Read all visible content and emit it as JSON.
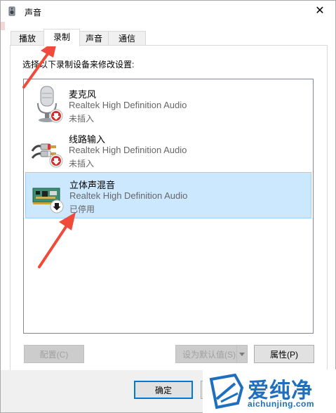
{
  "window": {
    "title": "声音",
    "close_glyph": "✕",
    "icon": "speaker-icon"
  },
  "tabs": [
    {
      "label": "播放",
      "active": false
    },
    {
      "label": "录制",
      "active": true
    },
    {
      "label": "声音",
      "active": false
    },
    {
      "label": "通信",
      "active": false
    }
  ],
  "panel": {
    "instruction": "选择以下录制设备来修改设置:"
  },
  "devices": [
    {
      "name": "麦克风",
      "driver": "Realtek High Definition Audio",
      "status": "未插入",
      "icon": "microphone-icon",
      "badge": "red-down-arrow-badge",
      "selected": false
    },
    {
      "name": "线路输入",
      "driver": "Realtek High Definition Audio",
      "status": "未插入",
      "icon": "line-in-cable-icon",
      "badge": "red-down-arrow-badge",
      "selected": false
    },
    {
      "name": "立体声混音",
      "driver": "Realtek High Definition Audio",
      "status": "已停用",
      "icon": "sound-card-icon",
      "badge": "black-down-arrow-badge",
      "selected": true
    }
  ],
  "buttons": {
    "configure": "配置(C)",
    "set_default": "设为默认值(S)",
    "properties": "属性(P)",
    "ok": "确定",
    "cancel": ""
  },
  "colors": {
    "selection_bg": "#cce8ff",
    "selection_border": "#99d1ff",
    "annotation_arrow": "#f04a3a",
    "watermark": "#1e6fbf"
  },
  "watermark": {
    "brand": "爱纯净",
    "url": "aichunjing.com"
  }
}
